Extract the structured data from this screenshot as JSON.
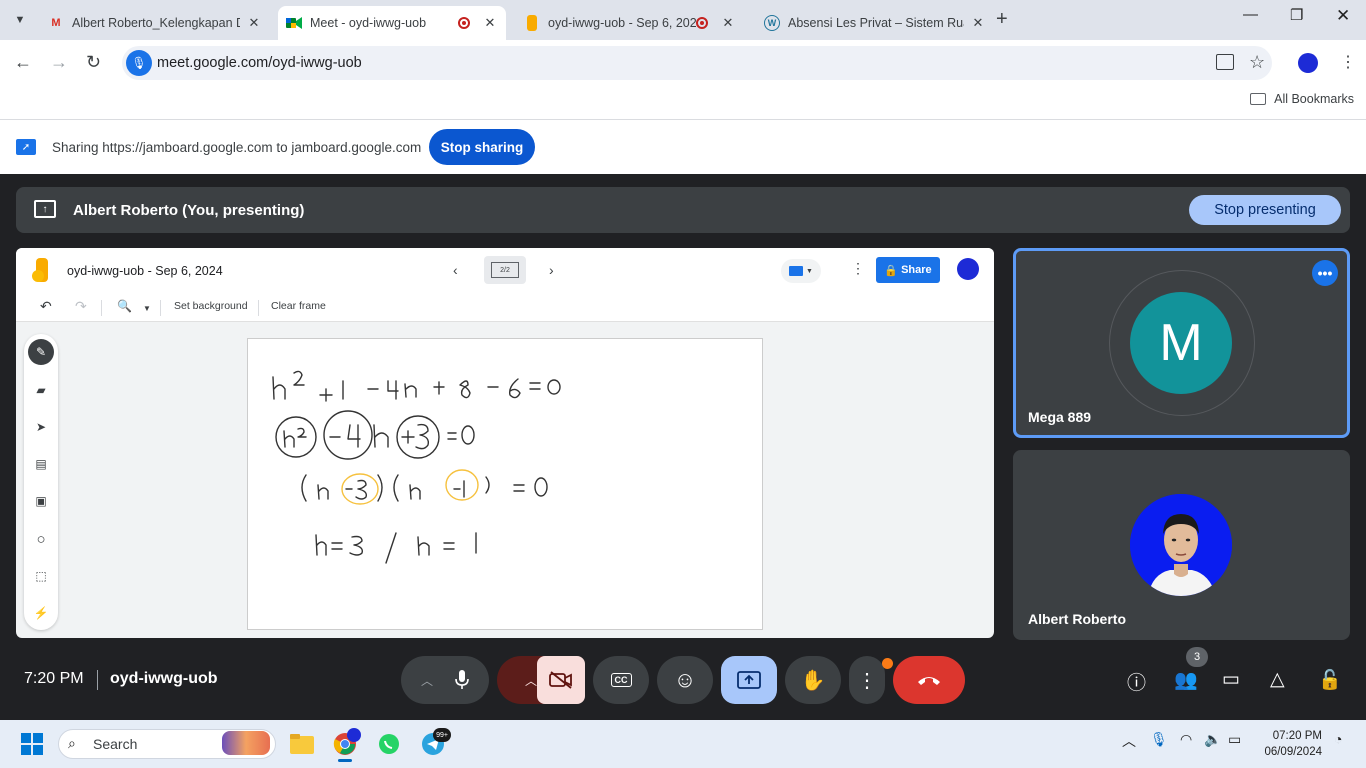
{
  "browser": {
    "tabs": [
      {
        "title": "Albert Roberto_Kelengkapan Do",
        "icon": "gmail-icon"
      },
      {
        "title": "Meet - oyd-iwwg-uob",
        "icon": "meet-icon",
        "active": true
      },
      {
        "title": "oyd-iwwg-uob - Sep 6, 2024",
        "icon": "jamboard-icon"
      },
      {
        "title": "Absensi Les Privat – Sistem Rua",
        "icon": "wordpress-icon"
      }
    ],
    "url": "meet.google.com/oyd-iwwg-uob",
    "all_bookmarks": "All Bookmarks"
  },
  "sharing_bar": {
    "text": "Sharing https://jamboard.google.com to jamboard.google.com",
    "stop_label": "Stop sharing"
  },
  "meet": {
    "presenter_text": "Albert Roberto (You, presenting)",
    "stop_presenting_label": "Stop presenting",
    "time": "7:20 PM",
    "meeting_code": "oyd-iwwg-uob",
    "people_count": "3",
    "participants": [
      {
        "name": "Mega 889",
        "initial": "M",
        "avatar_color": "#12939a"
      },
      {
        "name": "Albert Roberto"
      }
    ]
  },
  "jamboard": {
    "title": "oyd-iwwg-uob - Sep 6, 2024",
    "frame_indicator": "2/2",
    "share_label": "Share",
    "toolbar": {
      "set_background": "Set background",
      "clear_frame": "Clear frame"
    },
    "colors": {
      "ink": "#333333",
      "highlight": "#f6c13e"
    }
  },
  "taskbar": {
    "search_placeholder": "Search",
    "telegram_badge": "99+",
    "time": "07:20 PM",
    "date": "06/09/2024"
  }
}
